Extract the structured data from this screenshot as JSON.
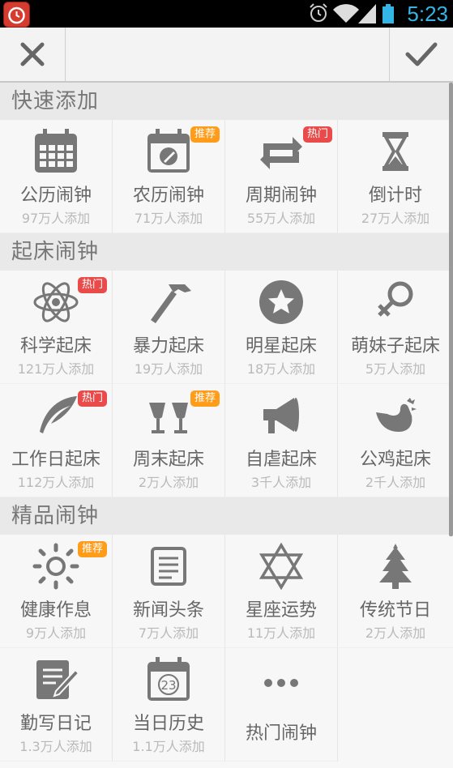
{
  "status_bar": {
    "time": "5:23"
  },
  "sections": [
    {
      "title": "快速添加",
      "items": [
        {
          "name": "公历闹钟",
          "count": "97万人添加",
          "icon": "calendar-grid-icon",
          "badge": ""
        },
        {
          "name": "农历闹钟",
          "count": "71万人添加",
          "icon": "lunar-calendar-icon",
          "badge": "推荐"
        },
        {
          "name": "周期闹钟",
          "count": "55万人添加",
          "icon": "repeat-icon",
          "badge": "热门"
        },
        {
          "name": "倒计时",
          "count": "27万人添加",
          "icon": "hourglass-icon",
          "badge": ""
        }
      ]
    },
    {
      "title": "起床闹钟",
      "items": [
        {
          "name": "科学起床",
          "count": "121万人添加",
          "icon": "atom-icon",
          "badge": "热门"
        },
        {
          "name": "暴力起床",
          "count": "19万人添加",
          "icon": "hammer-icon",
          "badge": ""
        },
        {
          "name": "明星起床",
          "count": "18万人添加",
          "icon": "star-circle-icon",
          "badge": ""
        },
        {
          "name": "萌妹子起床",
          "count": "5万人添加",
          "icon": "female-symbol-icon",
          "badge": ""
        },
        {
          "name": "工作日起床",
          "count": "112万人添加",
          "icon": "feather-icon",
          "badge": "热门"
        },
        {
          "name": "周末起床",
          "count": "2万人添加",
          "icon": "wine-glasses-icon",
          "badge": "推荐"
        },
        {
          "name": "自虐起床",
          "count": "3千人添加",
          "icon": "megaphone-icon",
          "badge": ""
        },
        {
          "name": "公鸡起床",
          "count": "2千人添加",
          "icon": "rooster-icon",
          "badge": ""
        }
      ]
    },
    {
      "title": "精品闹钟",
      "items": [
        {
          "name": "健康作息",
          "count": "9万人添加",
          "icon": "sun-icon",
          "badge": "推荐"
        },
        {
          "name": "新闻头条",
          "count": "7万人添加",
          "icon": "news-icon",
          "badge": ""
        },
        {
          "name": "星座运势",
          "count": "11万人添加",
          "icon": "hexagram-icon",
          "badge": ""
        },
        {
          "name": "传统节日",
          "count": "2万人添加",
          "icon": "christmas-tree-icon",
          "badge": ""
        },
        {
          "name": "勤写日记",
          "count": "1.3万人添加",
          "icon": "diary-icon",
          "badge": ""
        },
        {
          "name": "当日历史",
          "count": "1.1万人添加",
          "icon": "calendar-23-icon",
          "badge": "",
          "icon_text": "23"
        },
        {
          "name": "热门闹钟",
          "count": "",
          "icon": "more-dots-icon",
          "badge": ""
        }
      ]
    }
  ]
}
